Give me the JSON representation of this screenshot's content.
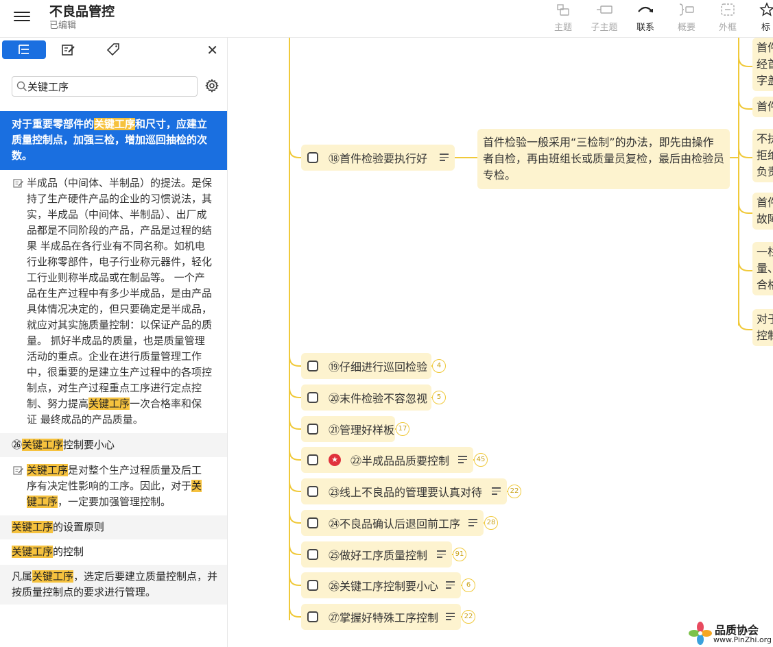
{
  "header": {
    "title": "不良品管控",
    "status": "已编辑"
  },
  "toolbar": [
    {
      "label": "主题",
      "icon": "topic-icon",
      "active": false
    },
    {
      "label": "子主题",
      "icon": "subtopic-icon",
      "active": false
    },
    {
      "label": "联系",
      "icon": "relationship-icon",
      "active": true
    },
    {
      "label": "概要",
      "icon": "summary-icon",
      "active": false
    },
    {
      "label": "外框",
      "icon": "boundary-icon",
      "active": false
    },
    {
      "label": "标",
      "icon": "marker-star-icon",
      "active": true
    }
  ],
  "sidebar": {
    "search_value": "关键工序",
    "results": [
      {
        "type": "selected",
        "parts": [
          "对于重要零部件的",
          "关键工序",
          "和尺寸，应建立质量控制点，加强三检，增加巡回抽检的次数。"
        ]
      },
      {
        "type": "note",
        "parts": [
          "半成品（中间体、半制品）的提法。是保持了生产硬件产品的企业的习惯说法，其实，半成品（中间体、半制品）、出厂成品都是不同阶段的产品，产品是过程的结果 半成品在各行业有不同名称。如机电行业称零部件，电子行业称元器件，轻化工行业则称半成品或在制品等。 一个产品在生产过程中有多少半成品，是由产品具体情况决定的，但只要确定是半成品，就应对其实施质量控制：以保证产品的质量。 抓好半成品的质量，也是质量管理活动的重点。企业在进行质量管理工作中，很重要的是建立生产过程中的各项控制点，对生产过程重点工序进行定点控制、努力提高",
          "关键工序",
          "一次合格率和保证 最终成品的产品质量。"
        ]
      },
      {
        "type": "gray",
        "parts": [
          "㉖",
          "关键工序",
          "控制要小心"
        ]
      },
      {
        "type": "note",
        "parts": [
          "",
          "关键工序",
          "是对整个生产过程质量及后工序有决定性影响的工序。因此，对于",
          "关键工序",
          "，一定要加强管理控制。"
        ]
      },
      {
        "type": "gray",
        "parts": [
          "",
          "关键工序",
          "的设置原则"
        ]
      },
      {
        "type": "white",
        "parts": [
          "",
          "关键工序",
          "的控制"
        ]
      },
      {
        "type": "gray",
        "parts": [
          "凡属",
          "关键工序",
          "，选定后要建立质量控制点，并按质量控制点的要求进行管理。"
        ]
      }
    ]
  },
  "mindmap": {
    "main_node": {
      "label": "⑱首件检验要执行好"
    },
    "desc_node": "首件检验一般采用“三检制”的办法，即先由操作者自检，再由班组长或质量员复检，最后由检验员专检。",
    "right_nodes": [
      [
        "首件",
        "经首",
        "字盖"
      ],
      [
        "首件"
      ],
      [
        "不执",
        "拒绝",
        "负责"
      ],
      [
        "首件",
        "故障"
      ],
      [
        "一栏",
        "量、",
        "合格"
      ],
      [
        "对于",
        "控制"
      ]
    ],
    "nodes": [
      {
        "label": "⑲仔细进行巡回检验",
        "badge": "4",
        "menu": false,
        "star": false
      },
      {
        "label": "⑳末件检验不容忽视",
        "badge": "5",
        "menu": false,
        "star": false
      },
      {
        "label": "㉑管理好样板",
        "badge": "17",
        "menu": false,
        "star": false
      },
      {
        "label": "㉒半成品品质要控制",
        "badge": "45",
        "menu": true,
        "star": true
      },
      {
        "label": "㉓线上不良品的管理要认真对待",
        "badge": "22",
        "menu": true,
        "star": false
      },
      {
        "label": "㉔不良品确认后退回前工序",
        "badge": "28",
        "menu": true,
        "star": false
      },
      {
        "label": "㉕做好工序质量控制",
        "badge": "91",
        "menu": true,
        "star": false
      },
      {
        "label": "㉖关键工序控制要小心",
        "badge": "6",
        "menu": true,
        "star": false
      },
      {
        "label": "㉗掌握好特殊工序控制",
        "badge": "22",
        "menu": true,
        "star": false
      }
    ]
  },
  "watermark": {
    "name": "品质协会",
    "url": "www.PinZhi.org"
  },
  "colors": {
    "accent": "#1a6fe0",
    "highlight": "#f6c23e",
    "node_bg": "#fdf3cf",
    "branch_line": "#f0c93a"
  }
}
